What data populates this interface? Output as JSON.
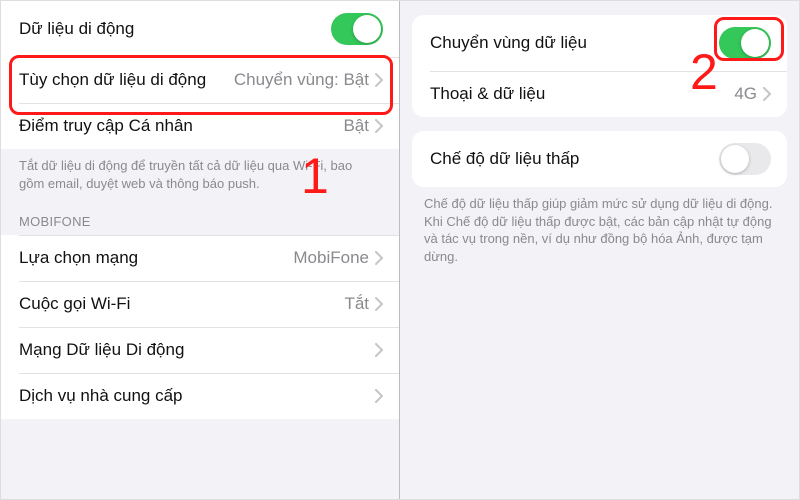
{
  "left": {
    "group1": {
      "mobile_data": {
        "title": "Dữ liệu di động",
        "on": true
      },
      "options": {
        "title": "Tùy chọn dữ liệu di động",
        "value": "Chuyển vùng: Bật"
      },
      "hotspot": {
        "title": "Điểm truy cập Cá nhân",
        "value": "Bật"
      }
    },
    "footer1": "Tắt dữ liệu di động để truyền tất cả dữ liệu qua Wi-Fi, bao gồm email, duyệt web và thông báo push.",
    "section_header": "MOBIFONE",
    "group2": {
      "network_select": {
        "title": "Lựa chọn mạng",
        "value": "MobiFone"
      },
      "wifi_calling": {
        "title": "Cuộc gọi Wi-Fi",
        "value": "Tắt"
      },
      "mobile_data_net": {
        "title": "Mạng Dữ liệu Di động",
        "value": ""
      },
      "carrier_services": {
        "title": "Dịch vụ nhà cung cấp",
        "value": ""
      }
    }
  },
  "right": {
    "group1": {
      "roaming": {
        "title": "Chuyển vùng dữ liệu",
        "on": true
      },
      "voice_data": {
        "title": "Thoại & dữ liệu",
        "value": "4G"
      }
    },
    "group2": {
      "low_data": {
        "title": "Chế độ dữ liệu thấp",
        "on": false
      }
    },
    "footer2": "Chế độ dữ liệu thấp giúp giảm mức sử dụng dữ liệu di động. Khi Chế độ dữ liệu thấp được bật, các bản cập nhật tự động và tác vụ trong nền, ví dụ như đồng bộ hóa Ảnh, được tạm dừng."
  },
  "annotations": {
    "one": "1",
    "two": "2"
  }
}
